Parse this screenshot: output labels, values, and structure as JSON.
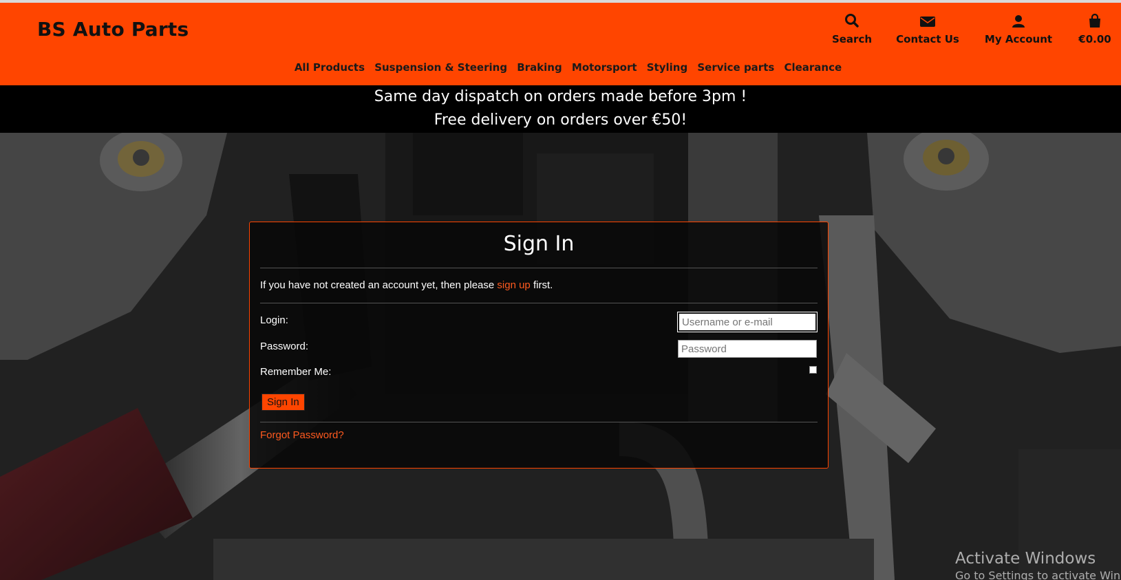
{
  "site": {
    "brand": "BS Auto Parts",
    "accent_color": "#ff4500"
  },
  "header": {
    "actions": [
      {
        "label": "Search",
        "icon": "search-icon"
      },
      {
        "label": "Contact Us",
        "icon": "envelope-icon"
      },
      {
        "label": "My Account",
        "icon": "user-icon"
      },
      {
        "label": "€0.00",
        "icon": "shopping-bag-icon"
      }
    ]
  },
  "nav": {
    "items": [
      "All Products",
      "Suspension & Steering",
      "Braking",
      "Motorsport",
      "Styling",
      "Service parts",
      "Clearance"
    ]
  },
  "banner": {
    "line1": "Same day dispatch on orders made before 3pm !",
    "line2": "Free delivery on orders over €50!"
  },
  "signin": {
    "title": "Sign In",
    "intro_before": "If you have not created an account yet, then please ",
    "intro_link": "sign up",
    "intro_after": " first.",
    "login_label": "Login:",
    "login_placeholder": "Username or e-mail",
    "password_label": "Password:",
    "password_placeholder": "Password",
    "remember_label": "Remember Me:",
    "remember_checked": false,
    "submit_label": "Sign In",
    "forgot_label": "Forgot Password?"
  },
  "os_overlay": {
    "title": "Activate Windows",
    "subtitle": "Go to Settings to activate Windows."
  }
}
